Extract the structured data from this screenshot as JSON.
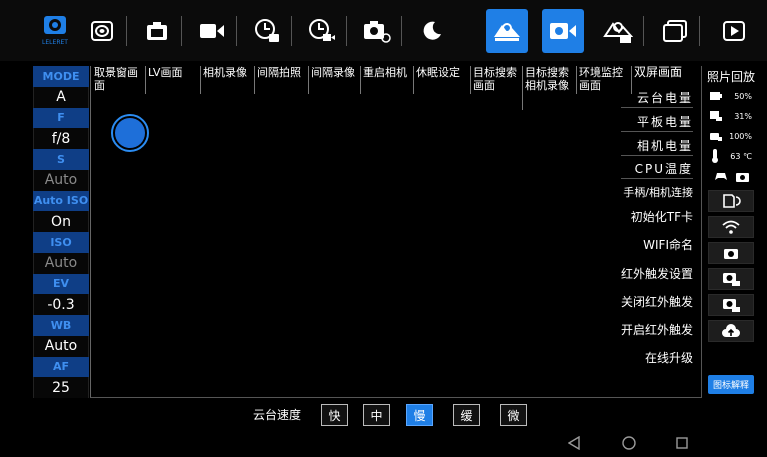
{
  "toolbar": {
    "brand_text": "LELERET",
    "icons": [
      "logo-icon",
      "lens-cap-icon",
      "camera-icon",
      "video-camera-icon",
      "interval-photo-icon",
      "interval-video-icon",
      "camera-restart-icon",
      "sleep-icon",
      "target-search-icon",
      "target-search-video-icon",
      "environment-monitor-icon",
      "dual-screen-icon",
      "play-icon"
    ],
    "active_color": "#1f7fe6"
  },
  "left_panel": {
    "items": [
      {
        "label": "MODE",
        "value": "A",
        "dim": false
      },
      {
        "label": "F",
        "value": "f/8",
        "dim": false
      },
      {
        "label": "S",
        "value": "Auto",
        "dim": true
      },
      {
        "label": "Auto ISO",
        "value": "On",
        "dim": false
      },
      {
        "label": "ISO",
        "value": "Auto",
        "dim": true
      },
      {
        "label": "EV",
        "value": "-0.3",
        "dim": false
      },
      {
        "label": "WB",
        "value": "Auto",
        "dim": false
      },
      {
        "label": "AF",
        "value": "25",
        "dim": false
      }
    ]
  },
  "main": {
    "tabs": [
      {
        "label": "取景窗画面"
      },
      {
        "label": "LV画面"
      },
      {
        "label": "相机录像"
      },
      {
        "label": "间隔拍照"
      },
      {
        "label": "间隔录像"
      },
      {
        "label": "重启相机"
      },
      {
        "label": "休眠设定"
      },
      {
        "label": "目标搜索画面"
      },
      {
        "label": "目标搜索相机录像"
      },
      {
        "label": "环境监控画面"
      },
      {
        "label": "双屏画面"
      }
    ],
    "right_labels": {
      "gimbal_battery": "云台电量",
      "tablet_battery": "平板电量",
      "camera_battery": "相机电量",
      "cpu_temp": "CPU温度",
      "controller_connect": "手柄/相机连接",
      "format_tf": "初始化TF卡",
      "wifi_name": "WIFI命名",
      "ir_trigger_settings": "红外触发设置",
      "ir_trigger_off": "关闭红外触发",
      "ir_trigger_on": "开启红外触发",
      "online_upgrade": "在线升级"
    }
  },
  "right_panel": {
    "title": "照片回放",
    "gimbal_battery": "50%",
    "tablet_battery": "31%",
    "camera_battery": "100%",
    "cpu_temp": "63 ℃",
    "legend_button": "图标解释"
  },
  "bottom": {
    "speed_label": "云台速度",
    "speeds": [
      {
        "label": "快",
        "active": false
      },
      {
        "label": "中",
        "active": false
      },
      {
        "label": "慢",
        "active": true
      },
      {
        "label": "缓",
        "active": false
      },
      {
        "label": "微",
        "active": false
      }
    ]
  }
}
